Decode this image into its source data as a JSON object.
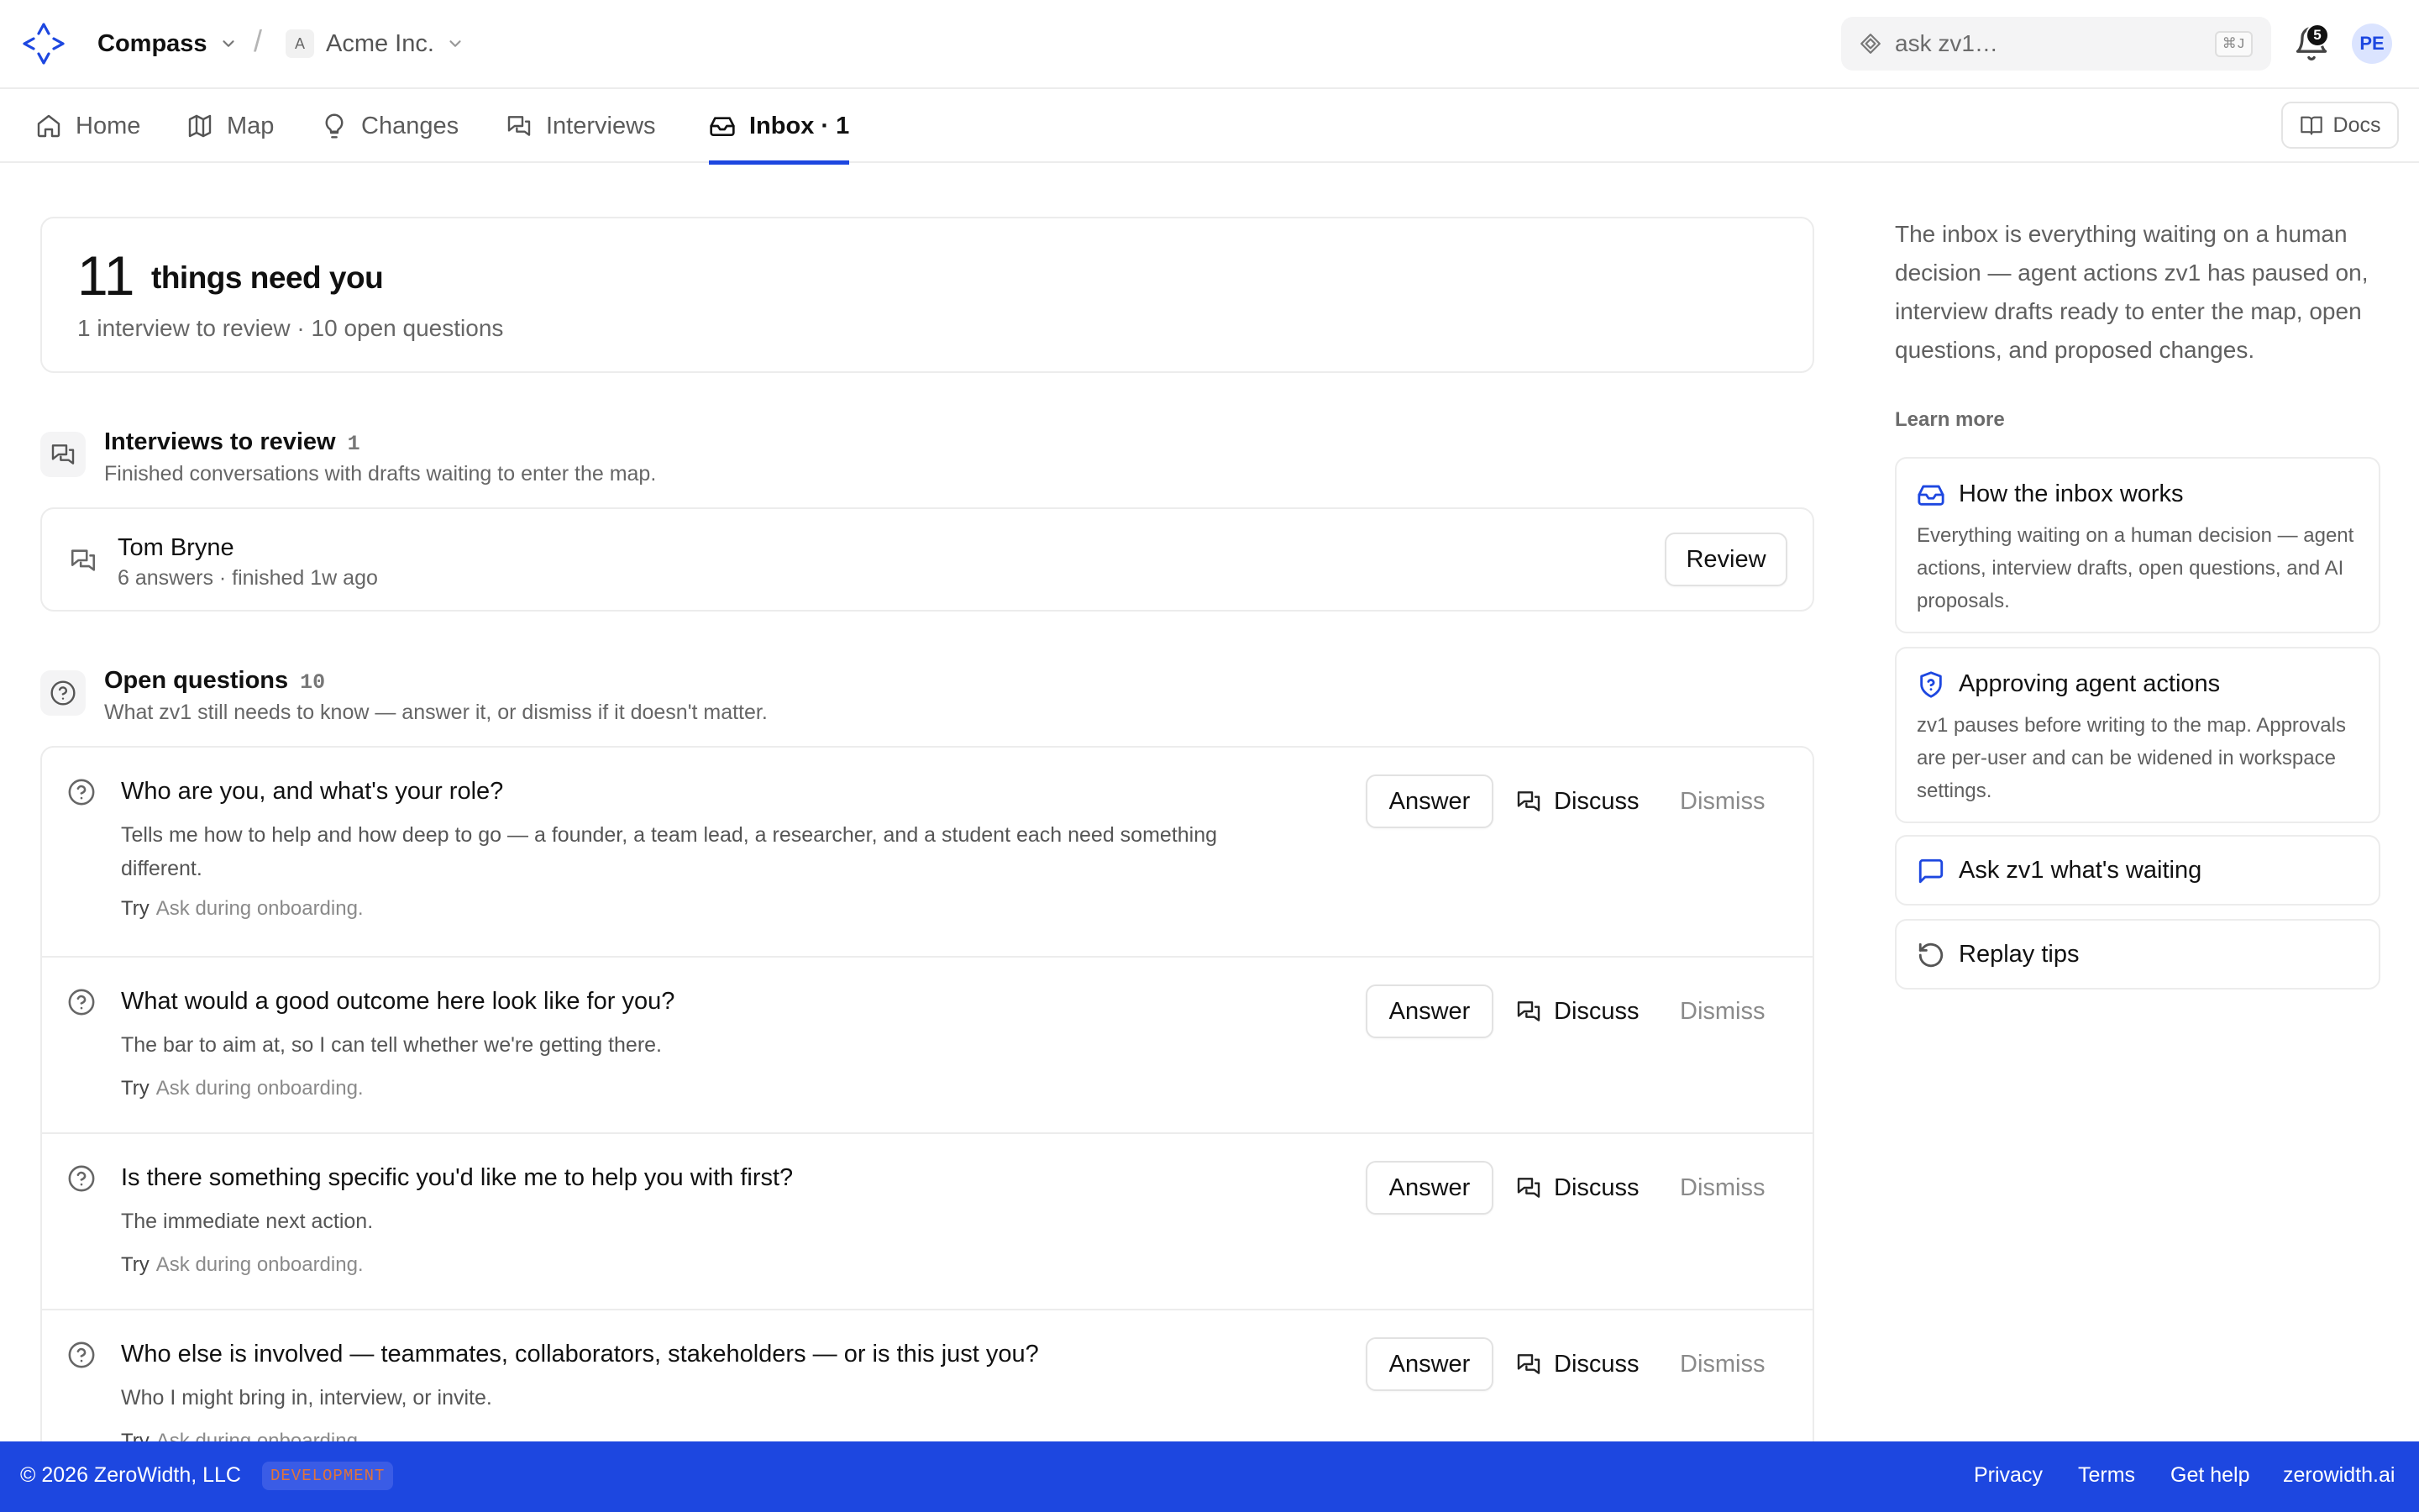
{
  "header": {
    "app_name": "Compass",
    "separator": "/",
    "org_initial": "A",
    "org_name": "Acme Inc.",
    "search_placeholder": "ask zv1…",
    "search_shortcut": "⌘J",
    "notification_count": "5",
    "user_initials": "PE"
  },
  "nav": {
    "tabs": [
      {
        "label": "Home",
        "icon": "home-icon"
      },
      {
        "label": "Map",
        "icon": "map-icon"
      },
      {
        "label": "Changes",
        "icon": "lightbulb-icon"
      },
      {
        "label": "Interviews",
        "icon": "chat-bubbles-icon"
      },
      {
        "label": "Inbox · 1",
        "icon": "inbox-icon",
        "active": true
      }
    ],
    "docs_label": "Docs"
  },
  "summary": {
    "count": "11",
    "title": "things need you",
    "subtitle": "1 interview to review · 10 open questions"
  },
  "interviews_section": {
    "title": "Interviews to review",
    "count": "1",
    "subtitle": "Finished conversations with drafts waiting to enter the map.",
    "items": [
      {
        "name": "Tom Bryne",
        "meta": "6 answers · finished 1w ago",
        "action": "Review"
      }
    ]
  },
  "questions_section": {
    "title": "Open questions",
    "count": "10",
    "subtitle": "What zv1 still needs to know — answer it, or dismiss if it doesn't matter.",
    "answer_label": "Answer",
    "discuss_label": "Discuss",
    "dismiss_label": "Dismiss",
    "try_label": "Try",
    "items": [
      {
        "title": "Who are you, and what's your role?",
        "description": "Tells me how to help and how deep to go — a founder, a team lead, a researcher, and a student each need something different.",
        "try": "Ask during onboarding."
      },
      {
        "title": "What would a good outcome here look like for you?",
        "description": "The bar to aim at, so I can tell whether we're getting there.",
        "try": "Ask during onboarding."
      },
      {
        "title": "Is there something specific you'd like me to help you with first?",
        "description": "The immediate next action.",
        "try": "Ask during onboarding."
      },
      {
        "title": "Who else is involved — teammates, collaborators, stakeholders — or is this just you?",
        "description": "Who I might bring in, interview, or invite.",
        "try": "Ask during onboarding."
      }
    ]
  },
  "sidebar": {
    "intro": "The inbox is everything waiting on a human decision — agent actions zv1 has paused on, interview drafts ready to enter the map, open questions, and proposed changes.",
    "learn_more": "Learn more",
    "cards": [
      {
        "title": "How the inbox works",
        "description": "Everything waiting on a human decision — agent actions, interview drafts, open questions, and AI proposals.",
        "icon": "inbox-icon"
      },
      {
        "title": "Approving agent actions",
        "description": "zv1 pauses before writing to the map. Approvals are per-user and can be widened in workspace settings.",
        "icon": "shield-question-icon"
      },
      {
        "title": "Ask zv1 what's waiting",
        "icon": "chat-icon"
      },
      {
        "title": "Replay tips",
        "icon": "replay-icon"
      }
    ]
  },
  "footer": {
    "copyright": "© 2026 ZeroWidth, LLC",
    "env": "DEVELOPMENT",
    "links": [
      "Privacy",
      "Terms",
      "Get help",
      "zerowidth.ai"
    ]
  },
  "colors": {
    "accent": "#1d47e0",
    "text": "#171717",
    "muted": "#666666",
    "border": "#ececec",
    "env_badge": "#e0733b"
  }
}
